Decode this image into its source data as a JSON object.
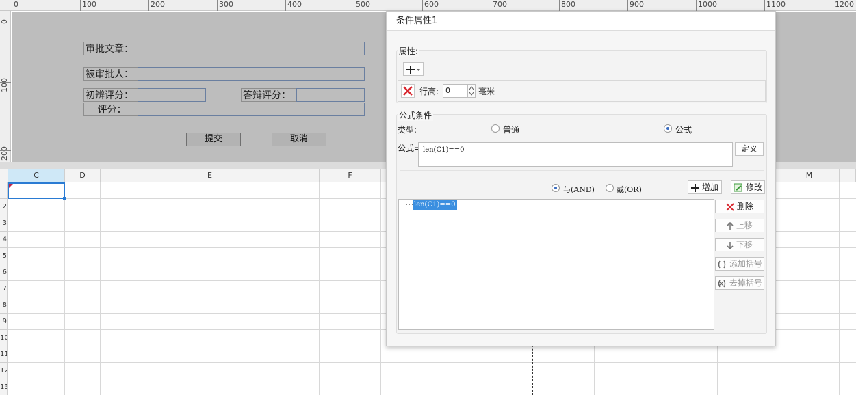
{
  "ruler": {
    "top_ticks": [
      "0",
      "100",
      "200",
      "300",
      "400",
      "500",
      "600",
      "700",
      "800",
      "900",
      "1000",
      "1100",
      "1200"
    ],
    "left_ticks": [
      "0",
      "100",
      "200"
    ]
  },
  "form": {
    "label_article": "审批文章：",
    "label_person": "被审批人：",
    "label_initial_score": "初辨评分：",
    "label_defense_score": "答辩评分：",
    "label_score": "评分：",
    "submit": "提交",
    "cancel": "取消"
  },
  "sheet": {
    "columns": [
      "C",
      "D",
      "E",
      "F",
      "M"
    ],
    "rows": [
      "2",
      "3",
      "4",
      "5",
      "6",
      "7",
      "8",
      "9",
      "10",
      "11",
      "12",
      "13"
    ],
    "row_first_marker": "1"
  },
  "dialog": {
    "title": "条件属性1",
    "properties_label": "属性:",
    "row_height_label": "行高:",
    "row_height_value": "0",
    "row_height_unit": "毫米",
    "formula_group_label": "公式条件",
    "type_label": "类型:",
    "type_normal": "普通",
    "type_formula": "公式",
    "formula_label": "公式=",
    "formula_value": "len(C1)==0",
    "define_button": "定义",
    "and_label": "与(AND)",
    "or_label": "或(OR)",
    "add_button": "增加",
    "modify_button": "修改",
    "condition_item": "len(C1)==0",
    "delete_button": "删除",
    "move_up_button": "上移",
    "move_down_button": "下移",
    "add_bracket_button": "添加括号",
    "remove_bracket_button": "去掉括号"
  },
  "colors": {
    "selection_blue": "#2a7bd3",
    "delete_red": "#d8262e",
    "tree_highlight": "#3b8fe0"
  }
}
